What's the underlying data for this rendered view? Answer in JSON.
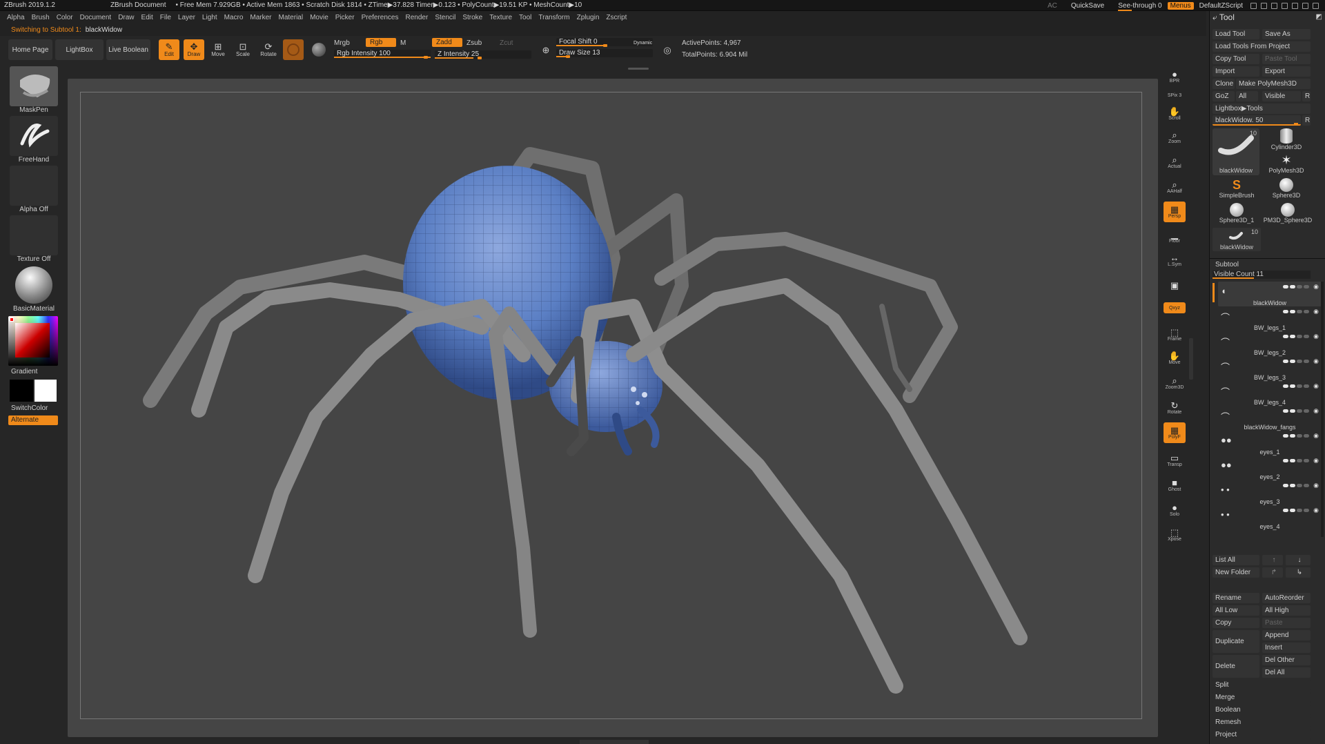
{
  "titlebar": {
    "app": "ZBrush 2019.1.2",
    "document": "ZBrush Document",
    "stats": "• Free Mem 7.929GB • Active Mem 1863 • Scratch Disk 1814 • ZTime▶37.828 Timer▶0.123 • PolyCount▶19.51 KP • MeshCount▶10",
    "ac": "AC",
    "quicksave": "QuickSave",
    "see_through": "See-through  0",
    "menus": "Menus",
    "default_script": "DefaultZScript"
  },
  "menu": [
    "Alpha",
    "Brush",
    "Color",
    "Document",
    "Draw",
    "Edit",
    "File",
    "Layer",
    "Light",
    "Macro",
    "Marker",
    "Material",
    "Movie",
    "Picker",
    "Preferences",
    "Render",
    "Stencil",
    "Stroke",
    "Texture",
    "Tool",
    "Transform",
    "Zplugin",
    "Zscript"
  ],
  "status": {
    "label": "Switching to Subtool 1:",
    "value": "blackWidow"
  },
  "toolbar": {
    "home": "Home Page",
    "lightbox": "LightBox",
    "live_boolean": "Live Boolean",
    "edit": "Edit",
    "draw": "Draw",
    "move": "Move",
    "scale": "Scale",
    "rotate": "Rotate",
    "mrgb": "Mrgb",
    "rgb": "Rgb",
    "m": "M",
    "zadd": "Zadd",
    "zsub": "Zsub",
    "zcut": "Zcut",
    "rgb_intensity": "Rgb Intensity 100",
    "z_intensity": "Z Intensity 25",
    "focal_shift": "Focal Shift 0",
    "draw_size": "Draw Size 13",
    "dynamic": "Dynamic",
    "active_points": "ActivePoints: 4,967",
    "total_points": "TotalPoints: 6.904 Mil"
  },
  "left_shelf": {
    "brush": "MaskPen",
    "stroke": "FreeHand",
    "alpha": "Alpha Off",
    "texture": "Texture Off",
    "material": "BasicMaterial",
    "gradient": "Gradient",
    "switch_color": "SwitchColor",
    "alternate": "Alternate"
  },
  "right_shelf": [
    {
      "name": "bpr",
      "label": "BPR",
      "icon": "●",
      "on": false
    },
    {
      "name": "spix",
      "label": "SPix 3",
      "icon": "",
      "on": false
    },
    {
      "name": "scroll",
      "label": "Scroll",
      "icon": "✋",
      "on": false
    },
    {
      "name": "zoom",
      "label": "Zoom",
      "icon": "⌕",
      "on": false
    },
    {
      "name": "actual",
      "label": "Actual",
      "icon": "⌕",
      "on": false
    },
    {
      "name": "aahalf",
      "label": "AAHalf",
      "icon": "⌕",
      "on": false
    },
    {
      "name": "persp",
      "label": "Persp",
      "icon": "▦",
      "on": true
    },
    {
      "name": "floor",
      "label": "Floor",
      "icon": "▁",
      "on": false
    },
    {
      "name": "lsym",
      "label": "L.Sym",
      "icon": "↔",
      "on": false
    },
    {
      "name": "lock",
      "label": "",
      "icon": "▣",
      "on": false
    },
    {
      "name": "xyz",
      "label": "Qxyz",
      "icon": "",
      "on": true
    },
    {
      "name": "frame",
      "label": "Frame",
      "icon": "⬚",
      "on": false
    },
    {
      "name": "move",
      "label": "Move",
      "icon": "✋",
      "on": false
    },
    {
      "name": "zoom3d",
      "label": "Zoom3D",
      "icon": "⌕",
      "on": false
    },
    {
      "name": "rotate",
      "label": "Rotate",
      "icon": "↻",
      "on": false
    },
    {
      "name": "polyf",
      "label": "PolyF",
      "icon": "▦",
      "on": true
    },
    {
      "name": "transp",
      "label": "Transp",
      "icon": "▭",
      "on": false
    },
    {
      "name": "ghost",
      "label": "Ghost",
      "icon": "■",
      "on": false
    },
    {
      "name": "solo",
      "label": "Solo",
      "icon": "●",
      "on": false
    },
    {
      "name": "xpose",
      "label": "Xpose",
      "icon": "⬚",
      "on": false
    }
  ],
  "tool": {
    "title": "Tool",
    "load_tool": "Load Tool",
    "save_as": "Save As",
    "load_from_project": "Load Tools From Project",
    "copy_tool": "Copy Tool",
    "paste_tool": "Paste Tool",
    "import": "Import",
    "export": "Export",
    "clone": "Clone",
    "make_polymesh": "Make PolyMesh3D",
    "goz": "GoZ",
    "all": "All",
    "visible": "Visible",
    "r": "R",
    "lightbox_tools": "Lightbox▶Tools",
    "current_tool": "blackWidow. 50",
    "thumbs": [
      {
        "label": "blackWidow",
        "count": "10"
      },
      {
        "label": "Cylinder3D",
        "count": ""
      },
      {
        "label": "PolyMesh3D",
        "count": ""
      },
      {
        "label": "SimpleBrush",
        "count": ""
      },
      {
        "label": "Sphere3D",
        "count": ""
      },
      {
        "label": "Sphere3D_1",
        "count": ""
      },
      {
        "label": "PM3D_Sphere3D",
        "count": ""
      },
      {
        "label": "blackWidow",
        "count": "10"
      }
    ],
    "subtool_title": "Subtool",
    "visible_count": "Visible Count 11",
    "subtools": [
      "blackWidow",
      "BW_legs_1",
      "BW_legs_2",
      "BW_legs_3",
      "BW_legs_4",
      "blackWidow_fangs",
      "eyes_1",
      "eyes_2",
      "eyes_3",
      "eyes_4"
    ],
    "list_all": "List All",
    "new_folder": "New Folder",
    "rename": "Rename",
    "auto_reorder": "AutoReorder",
    "all_low": "All Low",
    "all_high": "All High",
    "copy": "Copy",
    "paste": "Paste",
    "duplicate": "Duplicate",
    "append": "Append",
    "insert": "Insert",
    "delete": "Delete",
    "del_other": "Del Other",
    "del_all": "Del All",
    "split": "Split",
    "merge": "Merge",
    "boolean": "Boolean",
    "remesh": "Remesh",
    "project": "Project"
  },
  "colors": {
    "accent": "#f08a1a",
    "viewport": "#454545",
    "panel": "#2b2b2b",
    "mesh_blue": "#5b7fc4",
    "mesh_gray": "#8a8a8a"
  }
}
